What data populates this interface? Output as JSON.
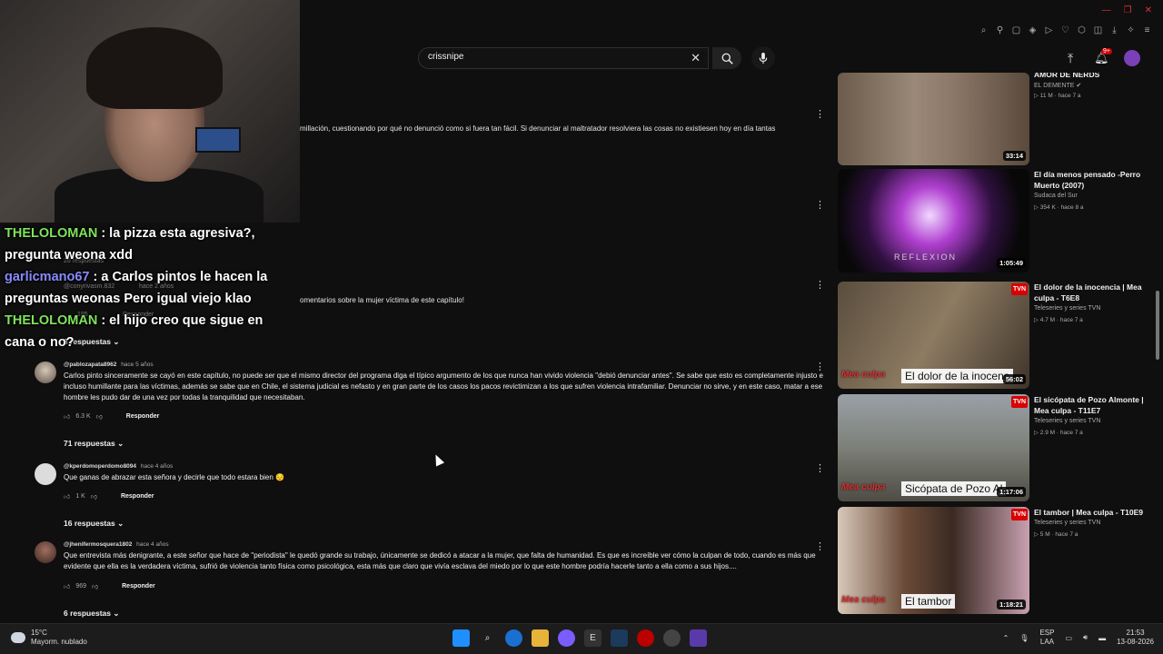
{
  "search": {
    "value": "crissnipe"
  },
  "notifications": {
    "badge": "9+"
  },
  "chat": [
    {
      "user": "THELOLOMAN",
      "color": "#7fe35b",
      "message": ": la pizza esta agresiva?, pregunta weona xdd"
    },
    {
      "user": "garlicmano67",
      "color": "#7c7cff",
      "message": ": a Carlos pintos le hacen la preguntas weonas Pero igual viejo klao"
    },
    {
      "user": "THELOLOMAN",
      "color": "#7fe35b",
      "message": ": el hijo creo que sigue en cana o no?"
    }
  ],
  "comments_partial": {
    "text": "millación, cuestionando por qué no denunció como si fuera tan fácil. Si denunciar al maltratador resolviera las cosas no existiesen hoy en día tantas",
    "hidden_replies": "28 respuestas",
    "hidden_author": "@conyrivasm.832",
    "hidden_time": "hace 2 años",
    "hidden_text": "omentarios sobre la mujer víctima de este capítulo!",
    "hidden_likes": "185",
    "hidden_reply": "Responder",
    "replies_3": "3 respuestas"
  },
  "comments": [
    {
      "author": "@pablozapata8962",
      "time": "hace 5 años",
      "text": "Carlos pinto sinceramente se cayó en este capítulo, no puede ser que el mismo director del programa diga el típico argumento de los que nunca han vivido violencia \"debió denunciar antes\". Se sabe que esto es completamente injusto e incluso humillante para las víctimas, además se sabe que en Chile, el sistema judicial es nefasto y en gran parte de los casos los pacos revictimizan a los que sufren violencia intrafamiliar. Denunciar no sirve, y en este caso, matar a ese hombre les pudo dar de una vez por todas la tranquilidad que necesitaban.",
      "likes": "6.3 K",
      "reply": "Responder",
      "replies": "71 respuestas"
    },
    {
      "author": "@kperdomoperdomo8094",
      "time": "hace 4 años",
      "text": "Que ganas de abrazar esta señora y decirle que todo estara bien 😔",
      "likes": "1 K",
      "reply": "Responder",
      "replies": "16 respuestas"
    },
    {
      "author": "@jhenifermosquera1802",
      "time": "hace 4 años",
      "text": "Que entrevista más denigrante, a este señor que hace de \"periodista\" le quedó grande su trabajo, únicamente se dedicó a atacar a la mujer, que falta de humanidad. Es que es increíble ver cómo la culpan de todo, cuando es más que evidente que ella es la verdadera víctima, sufrió de violencia tanto física como psicológica, esta más que claro que vivía esclava del miedo por lo que este hombre podría hacerle tanto a ella como a sus hijos....",
      "likes": "969",
      "reply": "Responder",
      "replies": "6 respuestas"
    }
  ],
  "videos": [
    {
      "title": "AMOR DE NERDS",
      "channel": "EL DEMENTE ✔",
      "meta": "▷ 11 M · hace 7 a",
      "duration": "33:14",
      "caption": ""
    },
    {
      "title": "El día menos pensado -Perro Muerto (2007)",
      "channel": "Sudaca del Sur",
      "meta": "▷ 354 K · hace 8 a",
      "duration": "1:05:49",
      "caption": ""
    },
    {
      "title": "El dolor de la inocencia | Mea culpa - T6E8",
      "channel": "Teleseries y series TVN",
      "meta": "▷ 4.7 M · hace 7 a",
      "duration": "56:02",
      "caption": "El dolor de la inocenc"
    },
    {
      "title": "El sicópata de Pozo Almonte | Mea culpa - T11E7",
      "channel": "Teleseries y series TVN",
      "meta": "▷ 2.9 M · hace 7 a",
      "duration": "1:17:06",
      "caption": "Sicópata de Pozo Al"
    },
    {
      "title": "El tambor | Mea culpa - T10E9",
      "channel": "Teleseries y series TVN",
      "meta": "▷ 5 M · hace 7 a",
      "duration": "1:18:21",
      "caption": "El tambor"
    }
  ],
  "thumb_overlay": {
    "reflexion": "REFLEXION",
    "tvn": "TVN",
    "mea": "Mea culpa"
  },
  "taskbar": {
    "temp": "15°C",
    "weather": "Mayorm. nublado",
    "lang": "ESP",
    "region": "LAA",
    "time": "21:53",
    "date": "13-08-2026"
  }
}
